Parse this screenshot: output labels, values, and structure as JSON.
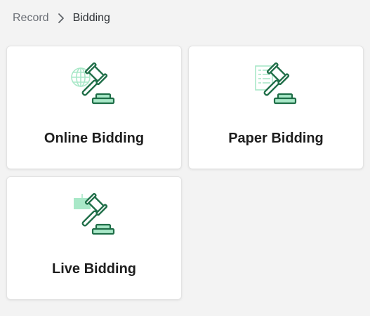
{
  "breadcrumb": {
    "parent": "Record",
    "current": "Bidding"
  },
  "cards": [
    {
      "title": "Online Bidding",
      "icon": "gavel-globe-icon"
    },
    {
      "title": "Paper Bidding",
      "icon": "gavel-paper-icon"
    },
    {
      "title": "Live Bidding",
      "icon": "gavel-live-icon"
    }
  ],
  "colors": {
    "icon_stroke": "#1f6e48",
    "icon_fill": "#a9e8c8",
    "background": "#f3f3f3"
  }
}
